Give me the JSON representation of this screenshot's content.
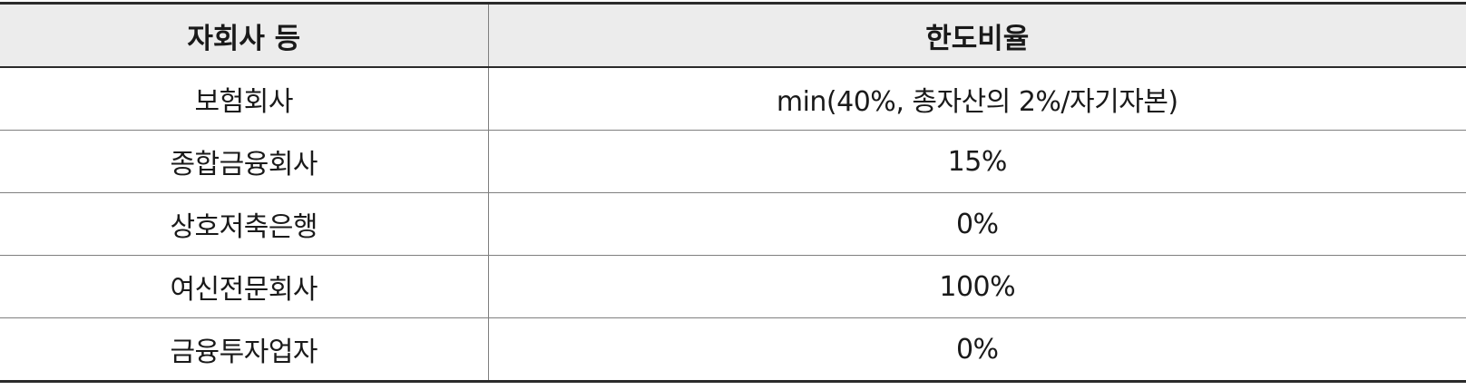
{
  "table": {
    "headers": [
      "자회사 등",
      "한도비율"
    ],
    "rows": [
      {
        "entity": "보험회사",
        "limit": "min(40%, 총자산의 2%/자기자본)"
      },
      {
        "entity": "종합금융회사",
        "limit": "15%"
      },
      {
        "entity": "상호저축은행",
        "limit": "0%"
      },
      {
        "entity": "여신전문회사",
        "limit": "100%"
      },
      {
        "entity": "금융투자업자",
        "limit": "0%"
      }
    ]
  }
}
